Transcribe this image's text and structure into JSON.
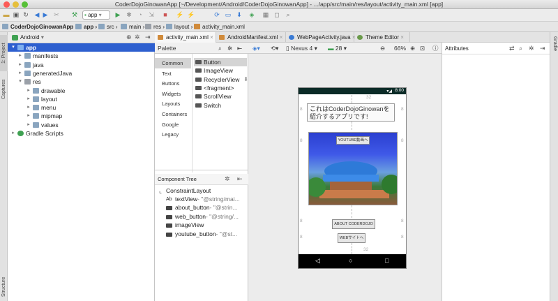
{
  "window": {
    "title": "CoderDojoGinowanApp [~/Development/Android/CoderDojoGinowanApp] - .../app/src/main/res/layout/activity_main.xml [app]"
  },
  "toolbar": {
    "run_config": "app"
  },
  "breadcrumb": [
    "CoderDojoGinowanApp",
    "app",
    "src",
    "main",
    "res",
    "layout",
    "activity_main.xml"
  ],
  "left_strip": {
    "project_tab": "1: Project",
    "captures_tab": "Captures",
    "structure_tab": "Structure"
  },
  "right_strip": {
    "gradle_tab": "Gradle"
  },
  "project": {
    "view": "Android",
    "tree": [
      {
        "label": "app",
        "depth": 0,
        "expanded": true,
        "selected": true
      },
      {
        "label": "manifests",
        "depth": 1,
        "expanded": false
      },
      {
        "label": "java",
        "depth": 1,
        "expanded": false
      },
      {
        "label": "generatedJava",
        "depth": 1,
        "expanded": false
      },
      {
        "label": "res",
        "depth": 1,
        "expanded": true
      },
      {
        "label": "drawable",
        "depth": 2,
        "expanded": false
      },
      {
        "label": "layout",
        "depth": 2,
        "expanded": false
      },
      {
        "label": "menu",
        "depth": 2,
        "expanded": false
      },
      {
        "label": "mipmap",
        "depth": 2,
        "expanded": false
      },
      {
        "label": "values",
        "depth": 2,
        "expanded": false
      },
      {
        "label": "Gradle Scripts",
        "depth": 0,
        "expanded": false
      }
    ]
  },
  "editor_tabs": [
    {
      "label": "activity_main.xml",
      "active": true
    },
    {
      "label": "AndroidManifest.xml",
      "active": false
    },
    {
      "label": "WebPageActivity.java",
      "active": false
    },
    {
      "label": "Theme Editor",
      "active": false
    }
  ],
  "palette": {
    "title": "Palette",
    "categories": [
      "Common",
      "Text",
      "Buttons",
      "Widgets",
      "Layouts",
      "Containers",
      "Google",
      "Legacy"
    ],
    "items": [
      "Button",
      "ImageView",
      "RecyclerView",
      "<fragment>",
      "ScrollView",
      "Switch"
    ]
  },
  "design": {
    "device": "Nexus 4",
    "api": "28",
    "zoom": "66%"
  },
  "component_tree": {
    "title": "Component Tree",
    "root": "ConstraintLayout",
    "children": [
      {
        "name": "textView",
        "detail": "- \"@string/mai..."
      },
      {
        "name": "about_button",
        "detail": "- \"@strin..."
      },
      {
        "name": "web_button",
        "detail": "- \"@string/..."
      },
      {
        "name": "imageView",
        "detail": ""
      },
      {
        "name": "youtube_button",
        "detail": "- \"@st..."
      }
    ]
  },
  "attributes": {
    "title": "Attributes"
  },
  "phone": {
    "status_time": "8:00",
    "text_view": "これはCoderDojoGinowanを紹介するアプリです!",
    "youtube_button": "YOUTUBE動画へ",
    "about_button": "ABOUT CODERDOJO",
    "web_button": "WEBサイトへ",
    "margins": [
      "32",
      "8",
      "8",
      "8",
      "8",
      "8",
      "8",
      "8",
      "8",
      "32"
    ]
  },
  "colors": {
    "selected_row": "#2d5fcf",
    "status_bar": "#0b2b27",
    "folder": "#8aa5bf",
    "res_folder": "#9aa0a8"
  }
}
